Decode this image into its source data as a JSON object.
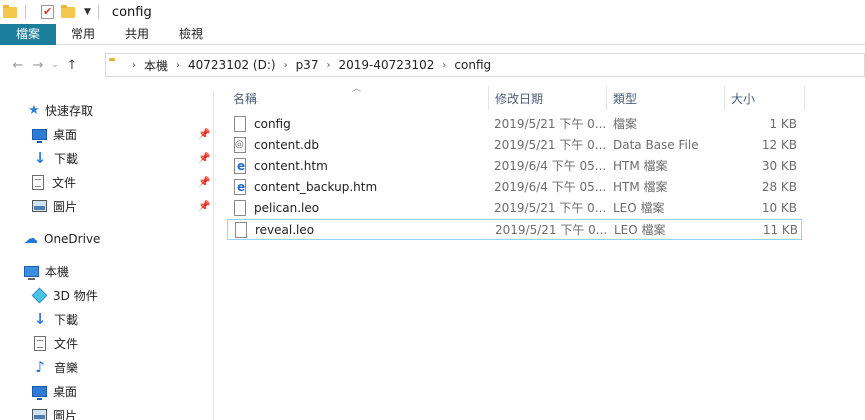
{
  "window": {
    "title": "config"
  },
  "ribbon": {
    "tabs": [
      "檔案",
      "常用",
      "共用",
      "檢視"
    ]
  },
  "address": {
    "crumbs": [
      "本機",
      "40723102 (D:)",
      "p37",
      "2019-40723102",
      "config"
    ]
  },
  "nav": {
    "quick_access": "快速存取",
    "quick_items": [
      "桌面",
      "下載",
      "文件",
      "圖片"
    ],
    "onedrive": "OneDrive",
    "this_pc": "本機",
    "pc_items": [
      "3D 物件",
      "下載",
      "文件",
      "音樂",
      "桌面",
      "圖片"
    ]
  },
  "columns": {
    "name": "名稱",
    "date": "修改日期",
    "type": "類型",
    "size": "大小"
  },
  "files": [
    {
      "name": "config",
      "date": "2019/5/21 下午 0...",
      "type": "檔案",
      "size": "1 KB",
      "icon": "file-icon"
    },
    {
      "name": "content.db",
      "date": "2019/5/21 下午 0...",
      "type": "Data Base File",
      "size": "12 KB",
      "icon": "database-file-icon"
    },
    {
      "name": "content.htm",
      "date": "2019/6/4 下午 05...",
      "type": "HTM 檔案",
      "size": "30 KB",
      "icon": "html-file-icon"
    },
    {
      "name": "content_backup.htm",
      "date": "2019/6/4 下午 05...",
      "type": "HTM 檔案",
      "size": "28 KB",
      "icon": "html-file-icon"
    },
    {
      "name": "pelican.leo",
      "date": "2019/5/21 下午 0...",
      "type": "LEO 檔案",
      "size": "10 KB",
      "icon": "file-icon"
    },
    {
      "name": "reveal.leo",
      "date": "2019/5/21 下午 0...",
      "type": "LEO 檔案",
      "size": "11 KB",
      "icon": "file-icon"
    }
  ],
  "selected_file": "reveal.leo"
}
